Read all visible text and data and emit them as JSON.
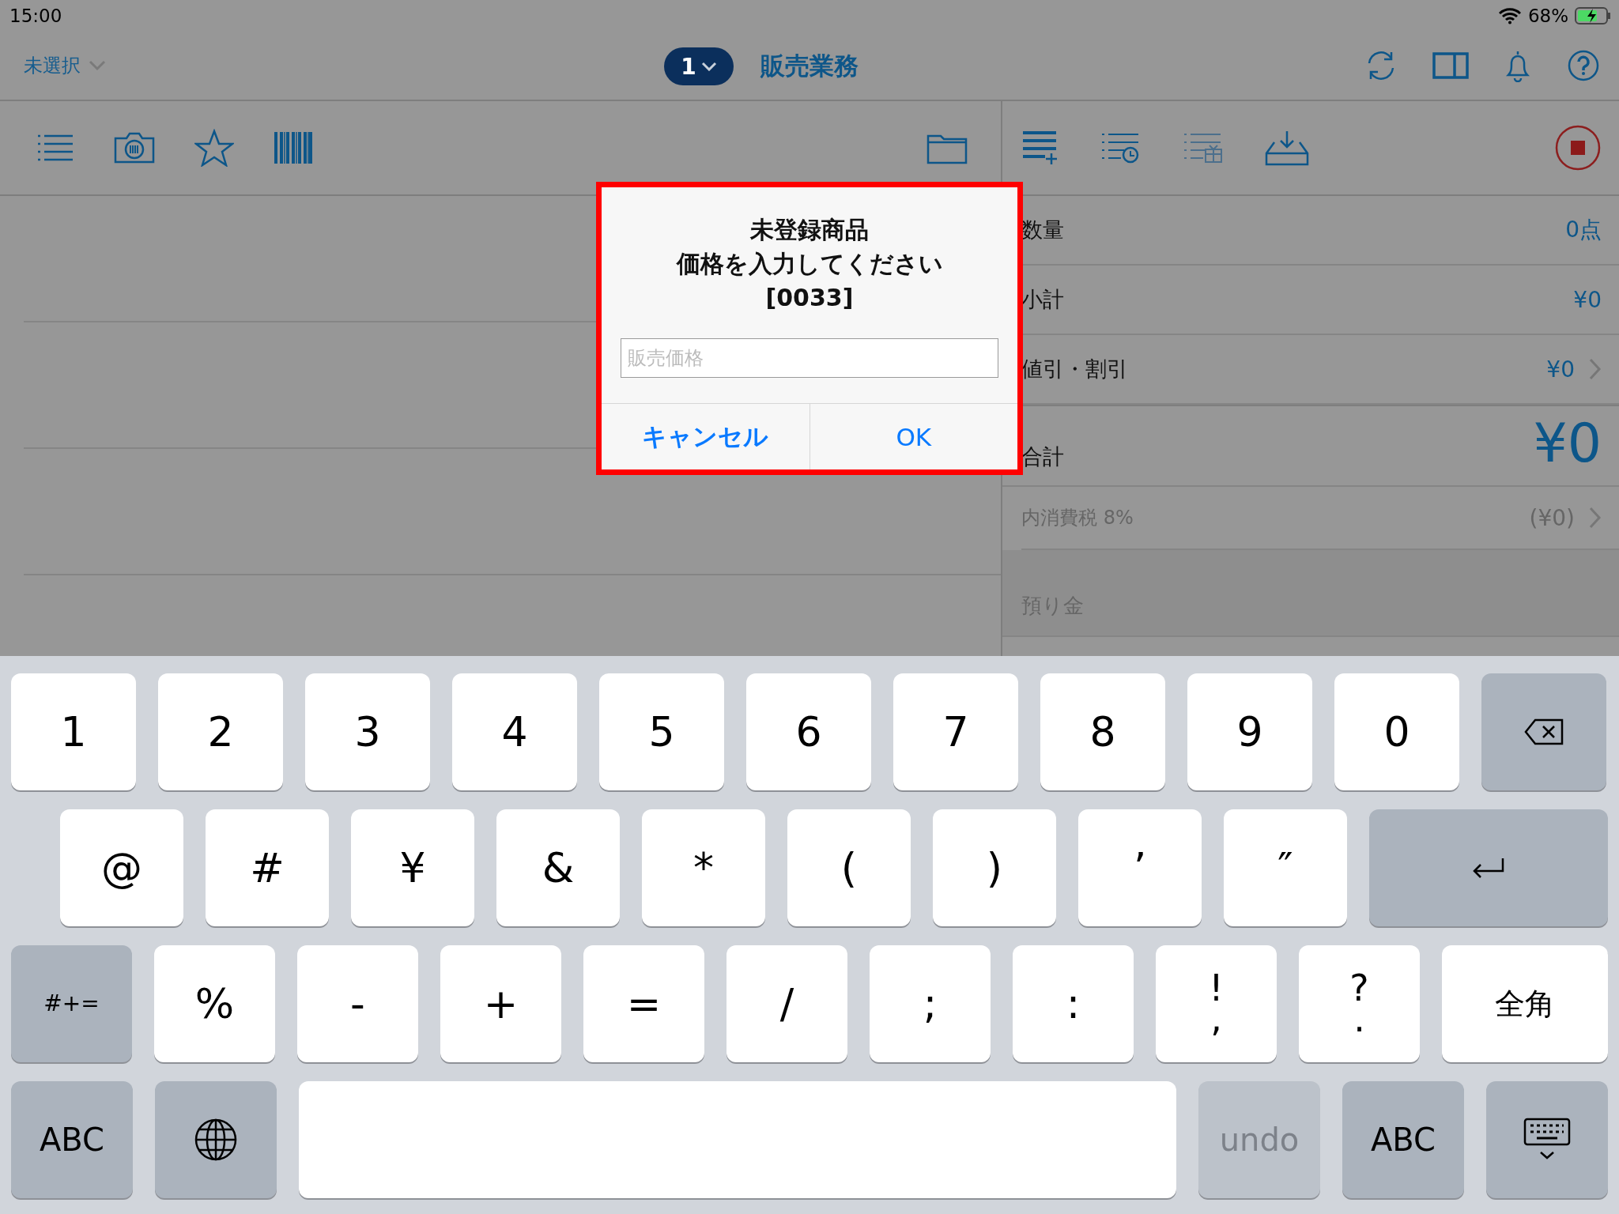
{
  "status_bar": {
    "time": "15:00",
    "battery_percent": "68%"
  },
  "header": {
    "store_selector": "未選択",
    "register_number": "1",
    "title": "販売業務"
  },
  "summary": [
    {
      "kind": "normal",
      "label": "数量",
      "value": "0点",
      "chevron": false
    },
    {
      "kind": "normal",
      "label": "小計",
      "value": "¥0",
      "chevron": false
    },
    {
      "kind": "normal",
      "label": "値引・割引",
      "value": "¥0",
      "chevron": true
    },
    {
      "kind": "total",
      "label": "合計",
      "value": "¥0",
      "chevron": false
    },
    {
      "kind": "tax",
      "label": "内消費税 8%",
      "value": "(¥0)",
      "chevron": true
    },
    {
      "kind": "deposit",
      "label": "預り金"
    }
  ],
  "dialog": {
    "title_lines": [
      "未登録商品",
      "価格を入力してください",
      "[0033]"
    ],
    "input": {
      "placeholder": "販売価格"
    },
    "buttons": [
      "キャンセル",
      "OK"
    ]
  },
  "keyboard": {
    "rows": [
      {
        "keys": [
          {
            "kind": "char",
            "label": "1"
          },
          {
            "kind": "char",
            "label": "2"
          },
          {
            "kind": "char",
            "label": "3"
          },
          {
            "kind": "char",
            "label": "4"
          },
          {
            "kind": "char",
            "label": "5"
          },
          {
            "kind": "char",
            "label": "6"
          },
          {
            "kind": "char",
            "label": "7"
          },
          {
            "kind": "char",
            "label": "8"
          },
          {
            "kind": "char",
            "label": "9"
          },
          {
            "kind": "char",
            "label": "0"
          },
          {
            "kind": "backspace"
          }
        ]
      },
      {
        "keys": [
          {
            "kind": "char",
            "label": "@"
          },
          {
            "kind": "char",
            "label": "#"
          },
          {
            "kind": "char",
            "label": "¥"
          },
          {
            "kind": "char",
            "label": "&"
          },
          {
            "kind": "char",
            "label": "*"
          },
          {
            "kind": "char",
            "label": "("
          },
          {
            "kind": "char",
            "label": ")"
          },
          {
            "kind": "char",
            "label": "’"
          },
          {
            "kind": "char",
            "label": "″"
          },
          {
            "kind": "return"
          }
        ]
      },
      {
        "keys": [
          {
            "kind": "func",
            "label": "#+="
          },
          {
            "kind": "char",
            "label": "%"
          },
          {
            "kind": "char",
            "label": "-"
          },
          {
            "kind": "char",
            "label": "+"
          },
          {
            "kind": "char",
            "label": "="
          },
          {
            "kind": "char",
            "label": "/"
          },
          {
            "kind": "char",
            "label": ";"
          },
          {
            "kind": "char",
            "label": ":"
          },
          {
            "kind": "char",
            "label": "!",
            "sub": ","
          },
          {
            "kind": "char",
            "label": "?",
            "sub": "."
          },
          {
            "kind": "mode",
            "label": "全角"
          }
        ]
      },
      {
        "keys": [
          {
            "kind": "func",
            "label": "ABC",
            "disabled": false
          },
          {
            "kind": "globe",
            "disabled": false
          },
          {
            "kind": "space",
            "disabled": false
          },
          {
            "kind": "func",
            "label": "undo",
            "disabled": true
          },
          {
            "kind": "func",
            "label": "ABC",
            "disabled": false
          },
          {
            "kind": "hide",
            "disabled": false
          }
        ]
      }
    ]
  }
}
